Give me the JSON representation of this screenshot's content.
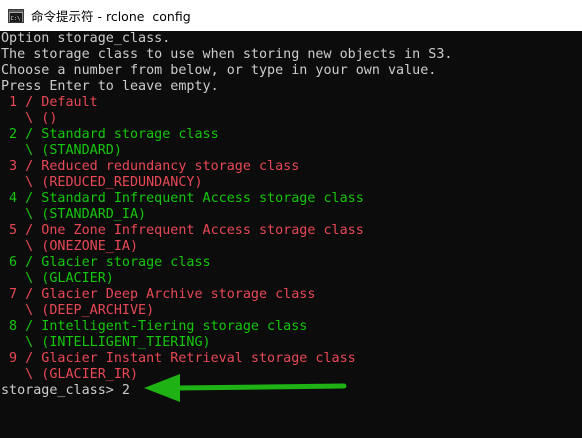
{
  "window": {
    "title": "命令提示符 - rclone  config",
    "icon": "cmd-console-icon"
  },
  "colors": {
    "background": "#0c0c0c",
    "text": "#cccccc",
    "option_odd": "#e74856",
    "option_even": "#16c60c",
    "annotation_arrow": "#1fb214"
  },
  "console": {
    "intro": [
      "Option storage_class.",
      "The storage class to use when storing new objects in S3.",
      "Choose a number from below, or type in your own value.",
      "Press Enter to leave empty."
    ],
    "options": [
      {
        "label": " 1 / Default",
        "value": "   \\ ()"
      },
      {
        "label": " 2 / Standard storage class",
        "value": "   \\ (STANDARD)"
      },
      {
        "label": " 3 / Reduced redundancy storage class",
        "value": "   \\ (REDUCED_REDUNDANCY)"
      },
      {
        "label": " 4 / Standard Infrequent Access storage class",
        "value": "   \\ (STANDARD_IA)"
      },
      {
        "label": " 5 / One Zone Infrequent Access storage class",
        "value": "   \\ (ONEZONE_IA)"
      },
      {
        "label": " 6 / Glacier storage class",
        "value": "   \\ (GLACIER)"
      },
      {
        "label": " 7 / Glacier Deep Archive storage class",
        "value": "   \\ (DEEP_ARCHIVE)"
      },
      {
        "label": " 8 / Intelligent-Tiering storage class",
        "value": "   \\ (INTELLIGENT_TIERING)"
      },
      {
        "label": " 9 / Glacier Instant Retrieval storage class",
        "value": "   \\ (GLACIER_IR)"
      }
    ],
    "prompt": "storage_class> 2"
  }
}
